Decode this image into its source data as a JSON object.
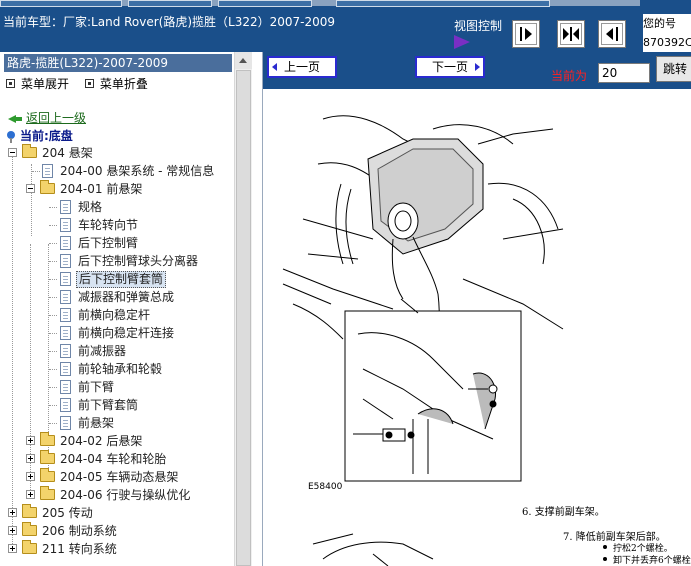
{
  "window": {
    "car_title": "当前车型：厂家:Land Rover(路虎)揽胜（L322）2007-2009",
    "view_control_label": "视图控制",
    "welcome_lines": [
      "您的号",
      "870392C"
    ]
  },
  "tree": {
    "header": "路虎-揽胜(L322)-2007-2009",
    "expand_all": "菜单展开",
    "collapse_all": "菜单折叠",
    "back_link": "返回上一级",
    "current": "当前:底盘",
    "nodes": [
      {
        "label": "204 悬架",
        "type": "folder",
        "expanded": true
      },
      {
        "label": "204-00 悬架系统 - 常规信息",
        "type": "doc"
      },
      {
        "label": "204-01 前悬架",
        "type": "folder",
        "expanded": true
      },
      {
        "label": "规格",
        "type": "doc"
      },
      {
        "label": "车轮转向节",
        "type": "doc"
      },
      {
        "label": "后下控制臂",
        "type": "doc"
      },
      {
        "label": "后下控制臂球头分离器",
        "type": "doc"
      },
      {
        "label": "后下控制臂套筒",
        "type": "doc",
        "selected": true
      },
      {
        "label": "减振器和弹簧总成",
        "type": "doc"
      },
      {
        "label": "前横向稳定杆",
        "type": "doc"
      },
      {
        "label": "前横向稳定杆连接",
        "type": "doc"
      },
      {
        "label": "前减振器",
        "type": "doc"
      },
      {
        "label": "前轮轴承和轮毂",
        "type": "doc"
      },
      {
        "label": "前下臂",
        "type": "doc"
      },
      {
        "label": "前下臂套筒",
        "type": "doc"
      },
      {
        "label": "前悬架",
        "type": "doc"
      },
      {
        "label": "204-02 后悬架",
        "type": "folder",
        "expanded": false
      },
      {
        "label": "204-04 车轮和轮胎",
        "type": "folder",
        "expanded": false
      },
      {
        "label": "204-05 车辆动态悬架",
        "type": "folder",
        "expanded": false
      },
      {
        "label": "204-06 行驶与操纵优化",
        "type": "folder",
        "expanded": false
      },
      {
        "label": "205 传动",
        "type": "folder",
        "expanded": false
      },
      {
        "label": "206 制动系统",
        "type": "folder",
        "expanded": false
      },
      {
        "label": "211 转向系统",
        "type": "folder",
        "expanded": false
      }
    ]
  },
  "nav": {
    "prev": "上一页",
    "next": "下一页",
    "current_label": "当前为",
    "page_value": "20",
    "jump": "跳转"
  },
  "document": {
    "figure_code": "E58400",
    "step6": "6.  支撑前副车架。",
    "step7": "7.  降低前副车架后部。",
    "bullets": [
      "拧松2个螺栓。",
      "卸下并丢弃6个螺栓。"
    ]
  }
}
